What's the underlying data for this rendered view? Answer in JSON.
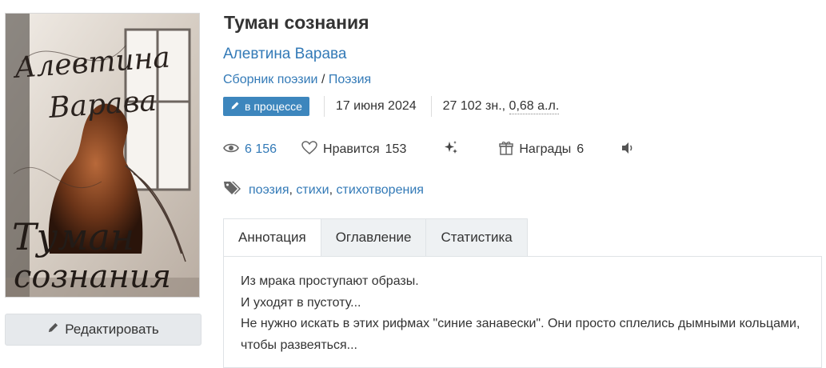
{
  "book": {
    "title": "Туман сознания",
    "author": "Алевтина Варава",
    "genre_1": "Сборник поэзии",
    "genre_sep": "/",
    "genre_2": "Поэзия",
    "status": "в процессе",
    "date": "17 июня 2024",
    "size_chars": "27 102 зн.,",
    "size_sheets": "0,68 а.л."
  },
  "cover": {
    "author_line1": "Алевтина",
    "author_line2": "Варава",
    "title_line1": "Туман",
    "title_line2": "сознания"
  },
  "stats": {
    "views": "6 156",
    "likes_label": "Нравится",
    "likes_count": "153",
    "awards_label": "Награды",
    "awards_count": "6"
  },
  "tags": [
    "поэзия",
    "стихи",
    "стихотворения"
  ],
  "tag_separator": ",",
  "tabs": [
    "Аннотация",
    "Оглавление",
    "Статистика"
  ],
  "annotation": [
    "Из мрака проступают образы.",
    "И уходят в пустоту...",
    "Не нужно искать в этих рифмах \"синие занавески\". Они просто сплелись дымными кольцами, чтобы развеяться..."
  ],
  "edit_button": "Редактировать",
  "icons": {
    "status": "pencil-icon",
    "edit": "pencil-icon",
    "views": "eye-icon",
    "likes": "heart-icon",
    "sparkle": "sparkles-icon",
    "awards": "gift-icon",
    "audio": "volume-icon",
    "tags": "tags-icon"
  },
  "colors": {
    "link": "#337ab7",
    "status_badge": "#3d86bd",
    "tab_inactive": "#eef1f3"
  }
}
